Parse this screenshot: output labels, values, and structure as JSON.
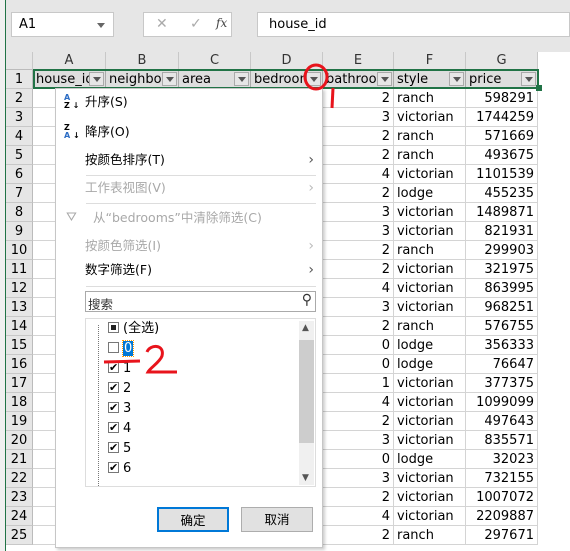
{
  "formula_bar": {
    "name_box": "A1",
    "cancel_icon": "✕",
    "enter_icon": "✓",
    "fx_label": "fx",
    "value": "house_id"
  },
  "columns": [
    "A",
    "B",
    "C",
    "D",
    "E",
    "F",
    "G"
  ],
  "header_row": [
    "house_id",
    "neighbo",
    "area",
    "bedroom",
    "bathroo",
    "style",
    "price"
  ],
  "rows": [
    {
      "n": "2",
      "e": "2",
      "f": "ranch",
      "g": "598291"
    },
    {
      "n": "3",
      "e": "3",
      "f": "victorian",
      "g": "1744259"
    },
    {
      "n": "4",
      "e": "2",
      "f": "ranch",
      "g": "571669"
    },
    {
      "n": "5",
      "e": "2",
      "f": "ranch",
      "g": "493675"
    },
    {
      "n": "6",
      "e": "4",
      "f": "victorian",
      "g": "1101539"
    },
    {
      "n": "7",
      "e": "2",
      "f": "lodge",
      "g": "455235"
    },
    {
      "n": "8",
      "e": "3",
      "f": "victorian",
      "g": "1489871"
    },
    {
      "n": "9",
      "e": "3",
      "f": "victorian",
      "g": "821931"
    },
    {
      "n": "10",
      "e": "2",
      "f": "ranch",
      "g": "299903"
    },
    {
      "n": "11",
      "e": "2",
      "f": "victorian",
      "g": "321975"
    },
    {
      "n": "12",
      "e": "4",
      "f": "victorian",
      "g": "863995"
    },
    {
      "n": "13",
      "e": "3",
      "f": "victorian",
      "g": "968251"
    },
    {
      "n": "14",
      "e": "2",
      "f": "ranch",
      "g": "576755"
    },
    {
      "n": "15",
      "e": "0",
      "f": "lodge",
      "g": "356333"
    },
    {
      "n": "16",
      "e": "0",
      "f": "lodge",
      "g": "76647"
    },
    {
      "n": "17",
      "e": "1",
      "f": "victorian",
      "g": "377375"
    },
    {
      "n": "18",
      "e": "4",
      "f": "victorian",
      "g": "1099099"
    },
    {
      "n": "19",
      "e": "2",
      "f": "victorian",
      "g": "497643"
    },
    {
      "n": "20",
      "e": "3",
      "f": "victorian",
      "g": "835571"
    },
    {
      "n": "21",
      "e": "0",
      "f": "lodge",
      "g": "32023"
    },
    {
      "n": "22",
      "e": "3",
      "f": "victorian",
      "g": "732155"
    },
    {
      "n": "23",
      "e": "2",
      "f": "victorian",
      "g": "1007072"
    },
    {
      "n": "24",
      "e": "4",
      "f": "victorian",
      "g": "2209887"
    },
    {
      "n": "25",
      "e": "2",
      "f": "ranch",
      "g": "297671"
    }
  ],
  "filter_menu": {
    "sort_asc": "升序(S)",
    "sort_desc": "降序(O)",
    "sort_by_color": "按颜色排序(T)",
    "sheet_view": "工作表视图(V)",
    "clear_filter": "从“bedrooms”中清除筛选(C)",
    "filter_by_color": "按颜色筛选(I)",
    "number_filter": "数字筛选(F)",
    "search_placeholder": "搜索",
    "items": [
      {
        "label": "(全选)",
        "state": "partial"
      },
      {
        "label": "0",
        "state": "unchecked"
      },
      {
        "label": "1",
        "state": "checked"
      },
      {
        "label": "2",
        "state": "checked"
      },
      {
        "label": "3",
        "state": "checked"
      },
      {
        "label": "4",
        "state": "checked"
      },
      {
        "label": "5",
        "state": "checked"
      },
      {
        "label": "6",
        "state": "checked"
      }
    ],
    "ok": "确定",
    "cancel": "取消"
  },
  "annotations": {
    "color": "#e8141c",
    "mark1": "1",
    "mark2": "2"
  }
}
